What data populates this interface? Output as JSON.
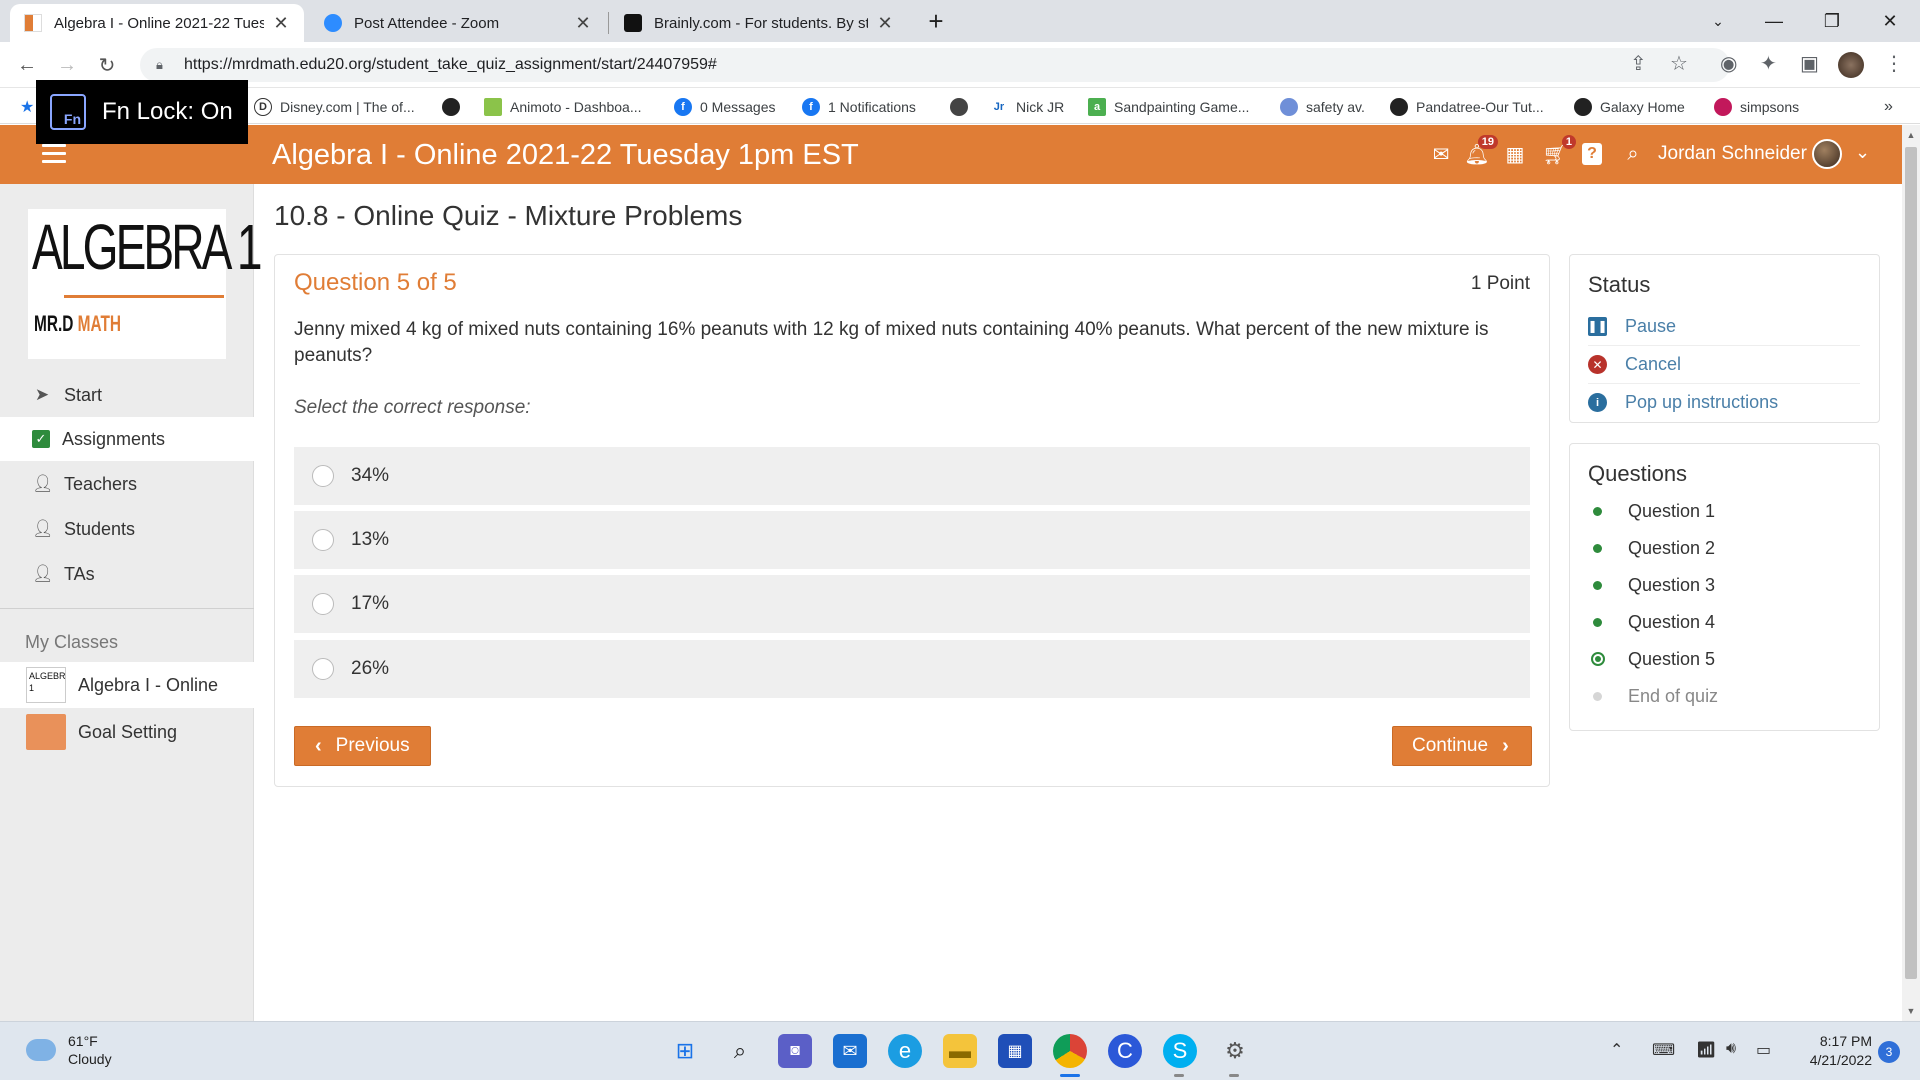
{
  "browser": {
    "tabs": [
      {
        "title": "Algebra I - Online 2021-22 Tuesd",
        "active": true
      },
      {
        "title": "Post Attendee - Zoom",
        "active": false
      },
      {
        "title": "Brainly.com - For students. By stu",
        "active": false
      }
    ],
    "url": "https://mrdmath.edu20.org/student_take_quiz_assignment/start/24407959#",
    "bookmarks": [
      "Disney.com | The of...",
      "Animoto - Dashboa...",
      "0 Messages",
      "1 Notifications",
      "Nick JR",
      "Sandpainting Game...",
      "safety av.",
      "Pandatree-Our Tut...",
      "Galaxy Home",
      "simpsons"
    ]
  },
  "overlay": {
    "fn_lock": "Fn Lock: On",
    "fn_key": "Fn"
  },
  "header": {
    "course_title": "Algebra I - Online 2021-22 Tuesday 1pm EST",
    "notifications_count": "19",
    "cart_count": "1",
    "username": "Jordan Schneider",
    "brand_color": "#e07d36"
  },
  "sidebar": {
    "logo_line1": "ALGEBRA 1",
    "logo_line2_a": "MR.D",
    "logo_line2_b": "MATH",
    "nav": [
      {
        "label": "Start",
        "icon": "location-arrow-icon"
      },
      {
        "label": "Assignments",
        "icon": "check-square-icon",
        "active": true
      },
      {
        "label": "Teachers",
        "icon": "user-icon"
      },
      {
        "label": "Students",
        "icon": "user-icon"
      },
      {
        "label": "TAs",
        "icon": "user-icon"
      }
    ],
    "my_classes_label": "My Classes",
    "classes": [
      {
        "label": "Algebra I - Online",
        "active": true
      },
      {
        "label": "Goal Setting",
        "active": false
      }
    ]
  },
  "quiz": {
    "title": "10.8 - Online Quiz - Mixture Problems",
    "question_number": "Question 5 of 5",
    "points": "1 Point",
    "question_text": "Jenny mixed 4 kg of mixed nuts containing 16% peanuts with 12 kg of mixed nuts containing 40% peanuts. What percent of the new mixture is peanuts?",
    "instruction": "Select the correct response:",
    "choices": [
      "34%",
      "13%",
      "17%",
      "26%"
    ],
    "previous_label": "Previous",
    "continue_label": "Continue"
  },
  "status_panel": {
    "title": "Status",
    "items": [
      "Pause",
      "Cancel",
      "Pop up instructions"
    ]
  },
  "questions_panel": {
    "title": "Questions",
    "items": [
      "Question 1",
      "Question 2",
      "Question 3",
      "Question 4",
      "Question 5",
      "End of quiz"
    ],
    "current_index": 4
  },
  "taskbar": {
    "temperature": "61°F",
    "condition": "Cloudy",
    "time": "8:17 PM",
    "date": "4/21/2022",
    "notification_count": "3"
  }
}
